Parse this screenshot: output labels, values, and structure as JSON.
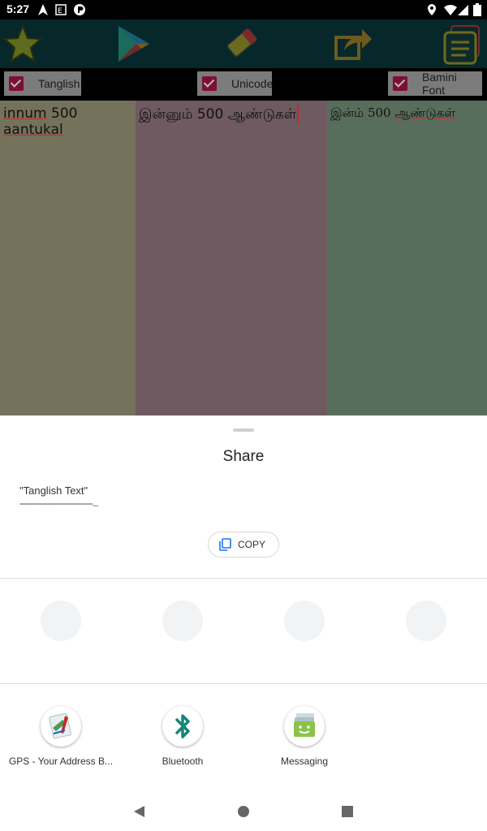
{
  "status_bar": {
    "time": "5:27",
    "icons": [
      "navigation-icon",
      "notification-icon",
      "app-notification-icon",
      "location-icon",
      "wifi-icon",
      "signal-icon",
      "battery-icon"
    ]
  },
  "toolbar": {
    "icons": [
      "star-icon",
      "play-store-icon",
      "eraser-icon",
      "share-icon",
      "notes-icon"
    ]
  },
  "checkboxes": [
    {
      "label": "Tanglish",
      "checked": true
    },
    {
      "label": "Unicode",
      "checked": true
    },
    {
      "label": "Bamini Font",
      "checked": true
    }
  ],
  "columns": {
    "tanglish": {
      "w1": "innum",
      "w2": " 500 ",
      "w3": "aantukal"
    },
    "unicode": {
      "text": "இன்னும் 500 ஆண்டுகள்"
    },
    "bamini": {
      "w1": "இன்ம்   500   ",
      "w2": "ஆண்டுகள்"
    }
  },
  "share_sheet": {
    "title": "Share",
    "preview_title": "\"Tanglish Text\"",
    "preview_line": "------------------------------...",
    "copy_label": "COPY",
    "apps": [
      {
        "label": "GPS - Your Address B...",
        "icon": "gps-address-book-icon"
      },
      {
        "label": "Bluetooth",
        "icon": "bluetooth-icon"
      },
      {
        "label": "Messaging",
        "icon": "messaging-icon"
      }
    ]
  },
  "navigation": {
    "icons": [
      "back-icon",
      "home-icon",
      "recents-icon"
    ]
  },
  "colors": {
    "checkbox_checked": "#7d0f37",
    "tanglish_bg": "#75725c",
    "unicode_bg": "#6f5a61",
    "bamini_bg": "#596d5d",
    "bluetooth": "#16857a",
    "messaging": "#8bc34a",
    "copy_icon": "#1a73e8"
  }
}
